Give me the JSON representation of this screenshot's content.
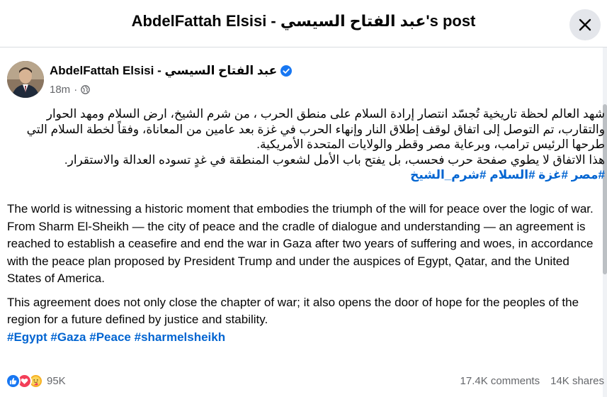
{
  "header": {
    "title": "AbdelFattah Elsisi - عبد الفتاح السيسي's post",
    "close_icon": "close-icon"
  },
  "post": {
    "author": "AbdelFattah Elsisi - عبد الفتاح السيسي",
    "verified_icon": "verified-badge-icon",
    "time": "18m",
    "separator": "·",
    "privacy_icon": "globe-icon",
    "arabic": {
      "paragraph1": "شهد العالم لحظة تاريخية تُجسّد انتصار إرادة السلام على منطق الحرب ، من شرم الشيخ، ارض السلام ومهد الحوار والتقارب، تم التوصل إلى اتفاق لوقف إطلاق النار وإنهاء الحرب في غزة بعد عامين من المعاناة، وفقاً لخطة السلام التي طرحها الرئيس ترامب، وبرعاية مصر وقطر والولايات المتحدة الأمريكية.",
      "paragraph2": "هذا الاتفاق لا يطوي صفحة حرب فحسب، بل يفتح باب الأمل لشعوب المنطقة في غدٍ تسوده العدالة والاستقرار.",
      "hashtags": [
        "#مصر",
        "#غزة",
        "#السلام",
        "#شرم_الشيخ"
      ]
    },
    "english": {
      "paragraph1": "The world is witnessing a historic moment that embodies the triumph of the will for peace over the logic of war.",
      "paragraph2": "From Sharm El-Sheikh — the city of peace and the cradle of dialogue and understanding — an agreement is reached to establish a ceasefire and end the war in Gaza after two years of suffering and woes, in accordance with the peace plan proposed by President Trump and under the auspices of Egypt, Qatar, and the United States of America.",
      "paragraph3": "This agreement does not only close the chapter of war; it also opens the door of hope for the peoples of the region for a future defined by justice and stability.",
      "hashtags": [
        "#Egypt",
        "#Gaza",
        "#Peace",
        "#sharmelsheikh"
      ]
    }
  },
  "footer": {
    "reaction_icons": [
      "like-reaction-icon",
      "love-reaction-icon",
      "care-reaction-icon"
    ],
    "reactions_count": "95K",
    "comments": "17.4K comments",
    "shares": "14K shares"
  },
  "colors": {
    "link": "#0064d1",
    "verified": "#1877f2",
    "like": "#1877f2",
    "love": "#f33e58",
    "care": "#f7b125",
    "secondary_text": "#65676b",
    "close_button_bg": "#e4e6eb"
  }
}
